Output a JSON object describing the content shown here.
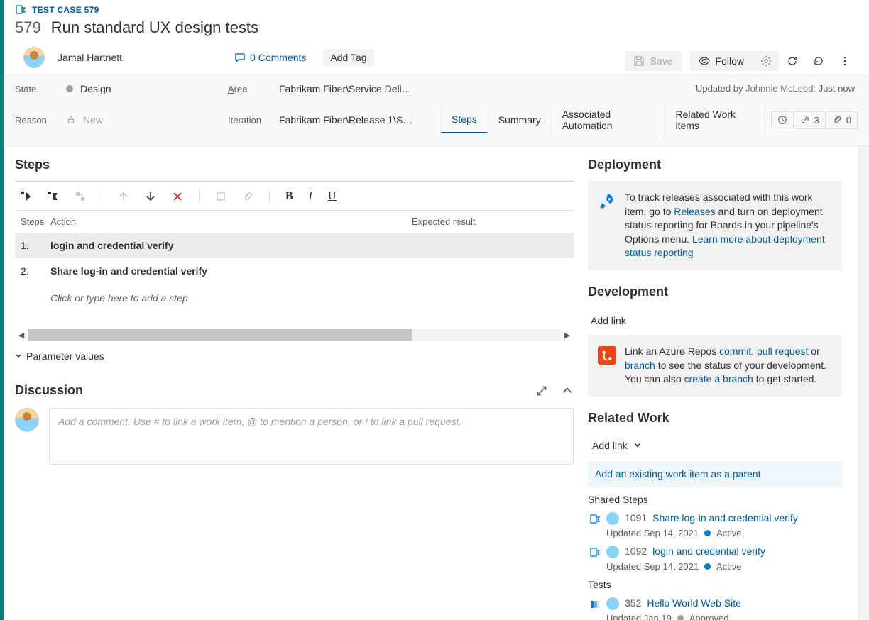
{
  "workItem": {
    "typeLabel": "TEST CASE 579",
    "id": "579",
    "title": "Run standard UX design tests",
    "assignee": "Jamal Hartnett",
    "commentsLabel": "0 Comments",
    "addTagLabel": "Add Tag"
  },
  "toolbar": {
    "save": "Save",
    "follow": "Follow"
  },
  "classification": {
    "stateLabel": "State",
    "stateValue": "Design",
    "reasonLabel": "Reason",
    "reasonValue": "New",
    "areaLabel": "Area",
    "areaValue": "Fabrikam Fiber\\Service Deli…",
    "iterationLabel": "Iteration",
    "iterationValue": "Fabrikam Fiber\\Release 1\\S…",
    "updatedPrefix": "Updated by ",
    "updatedBy": "Johnnie McLeod:",
    "updatedWhen": " Just now"
  },
  "tabs": {
    "steps": "Steps",
    "summary": "Summary",
    "automation": "Associated Automation",
    "related": "Related Work items",
    "linksCount": "3",
    "attachCount": "0"
  },
  "steps": {
    "heading": "Steps",
    "colSteps": "Steps",
    "colAction": "Action",
    "colExpected": "Expected result",
    "rows": [
      {
        "num": "1.",
        "action": "login and credential verify",
        "expected": ""
      },
      {
        "num": "2.",
        "action": "Share log-in and credential verify",
        "expected": ""
      }
    ],
    "ghost": "Click or type here to add a step",
    "paramLabel": "Parameter values"
  },
  "discussion": {
    "heading": "Discussion",
    "placeholder": "Add a comment. Use # to link a work item, @ to mention a person, or ! to link a pull request."
  },
  "deployment": {
    "heading": "Deployment",
    "text1": "To track releases associated with this work item, go to ",
    "link1": "Releases",
    "text2": " and turn on deployment status reporting for Boards in your pipeline's Options menu. ",
    "link2": "Learn more about deployment status reporting"
  },
  "development": {
    "heading": "Development",
    "addLink": "Add link",
    "text1": "Link an Azure Repos ",
    "linkCommit": "commit",
    "linkPR": "pull request",
    "textOr": " or ",
    "linkBranch": "branch",
    "text2": " to see the status of your development. You can also ",
    "linkCreate": "create a branch",
    "text3": " to get started."
  },
  "relatedWork": {
    "heading": "Related Work",
    "addLink": "Add link",
    "parentLink": "Add an existing work item as a parent",
    "sharedHead": "Shared Steps",
    "shared": [
      {
        "id": "1091",
        "title": "Share log-in and credential verify",
        "meta": "Updated Sep 14, 2021",
        "status": "Active",
        "dot": "blue"
      },
      {
        "id": "1092",
        "title": "login and credential verify",
        "meta": "Updated Sep 14, 2021",
        "status": "Active",
        "dot": "blue"
      }
    ],
    "testsHead": "Tests",
    "tests": [
      {
        "id": "352",
        "title": "Hello World Web Site",
        "meta": "Updated Jan 19",
        "status": "Approved",
        "dot": "gray"
      }
    ]
  }
}
